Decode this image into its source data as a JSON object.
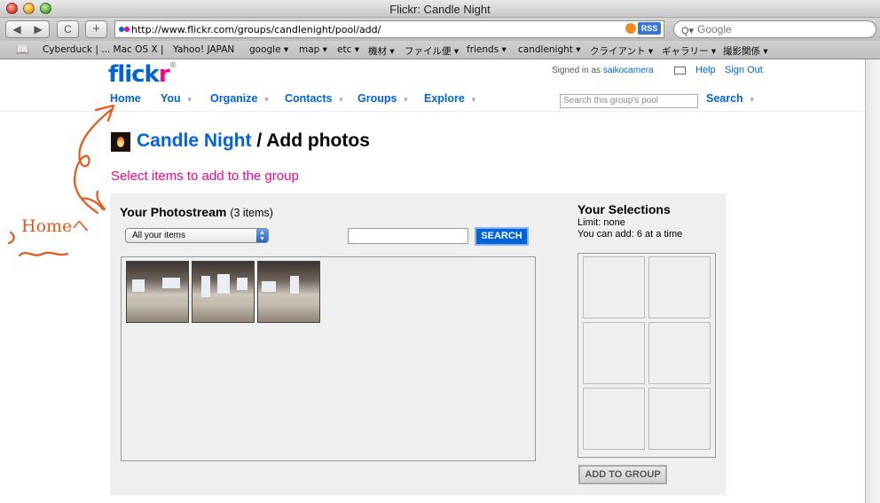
{
  "window": {
    "title": "Flickr: Candle Night"
  },
  "toolbar": {
    "back_icon": "back-arrow-icon",
    "forward_icon": "forward-arrow-icon",
    "reload_glyph": "C",
    "add_glyph": "+",
    "url": "http://www.flickr.com/groups/candlenight/pool/add/",
    "rss_label": "RSS",
    "search_placeholder": "Google"
  },
  "bookmarks": [
    "Cyberduck | ... Mac OS X |",
    "Yahoo! JAPAN",
    "google ▾",
    "map ▾",
    "etc ▾",
    "機材 ▾",
    "ファイル便 ▾",
    "friends ▾",
    "candlenight ▾",
    "クライアント ▾",
    "ギャラリー ▾",
    "撮影関係 ▾"
  ],
  "header": {
    "logo_blue": "flick",
    "logo_pink": "r",
    "signed_in_prefix": "Signed in as",
    "username": "saikocamera",
    "help": "Help",
    "sign_out": "Sign Out"
  },
  "nav": {
    "home": "Home",
    "you": "You",
    "organize": "Organize",
    "contacts": "Contacts",
    "groups": "Groups",
    "explore": "Explore",
    "pool_search_placeholder": "Search this group's pool",
    "search": "Search"
  },
  "page": {
    "group_name": "Candle Night",
    "heading_suffix": "/ Add photos",
    "instruction": "Select items to add to the group"
  },
  "photostream": {
    "title": "Your Photostream",
    "count": "(3 items)",
    "filter_selected": "All your items",
    "search_button": "SEARCH"
  },
  "selections": {
    "title": "Your Selections",
    "limit": "Limit: none",
    "can_add": "You can add: 6 at a time",
    "add_button": "ADD TO GROUP"
  },
  "annotation": {
    "text": "Homeへ",
    "color": "#e8571a"
  },
  "colors": {
    "flickr_blue": "#0063dc",
    "flickr_pink": "#ff0084"
  }
}
